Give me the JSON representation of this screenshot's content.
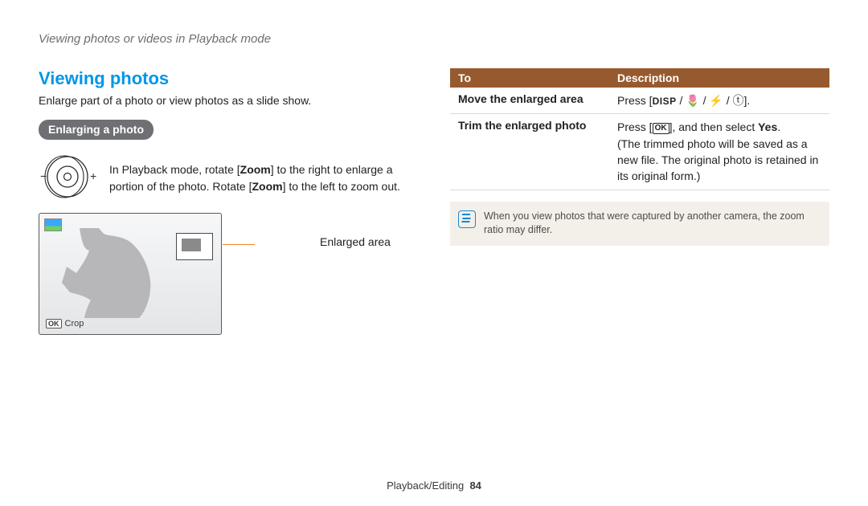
{
  "breadcrumb": "Viewing photos or videos in Playback mode",
  "section_title": "Viewing photos",
  "intro": "Enlarge part of a photo or view photos as a slide show.",
  "pill": "Enlarging a photo",
  "zoom_instr_pre": "In Playback mode, rotate [",
  "zoom_word": "Zoom",
  "zoom_instr_mid": "] to the right to enlarge a portion of the photo. Rotate [",
  "zoom_instr_end": "] to the left to zoom out.",
  "enlarged_area_label": "Enlarged area",
  "crop_label": "Crop",
  "table": {
    "head_to": "To",
    "head_desc": "Description",
    "rows": [
      {
        "action": "Move the enlarged area",
        "desc_prefix": "Press [",
        "glyphs": "DISP / 🌷 / ⚡ / 𝄐",
        "desc_suffix": "]."
      },
      {
        "action": "Trim the enlarged photo",
        "line1_pre": "Press [",
        "line1_ok": "OK",
        "line1_post": "], and then select ",
        "line1_yes": "Yes",
        "line1_end": ".",
        "line2": "(The trimmed photo will be saved as a new file. The original photo is retained in its original form.)"
      }
    ]
  },
  "note": "When you view photos that were captured by another camera, the zoom ratio may differ.",
  "footer_section": "Playback/Editing",
  "footer_page": "84"
}
